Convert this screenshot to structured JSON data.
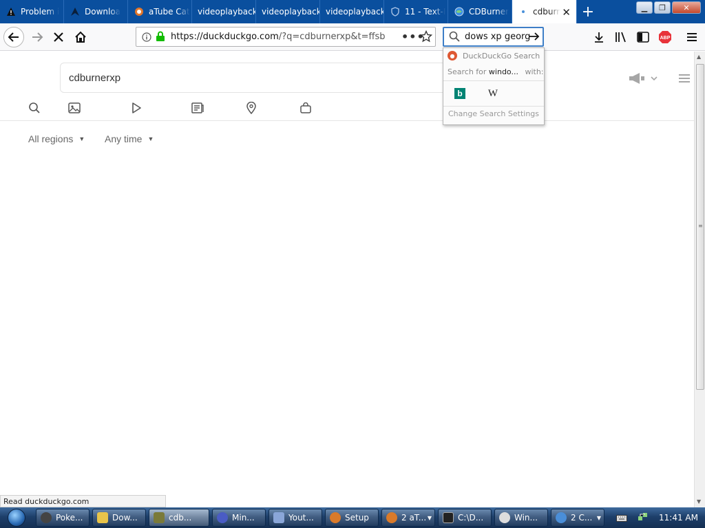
{
  "tabs": [
    {
      "label": "Problem i",
      "icon": "warning-icon"
    },
    {
      "label": "Downloa",
      "icon": "arrow-up-icon"
    },
    {
      "label": "aTube Cat",
      "icon": "atube-icon"
    },
    {
      "label": "videoplayback",
      "icon": ""
    },
    {
      "label": "videoplayback",
      "icon": ""
    },
    {
      "label": "videoplayback",
      "icon": ""
    },
    {
      "label": "11 - Text-I",
      "icon": "shield-icon"
    },
    {
      "label": "CDBurner",
      "icon": "globe-icon"
    },
    {
      "label": "cdburn",
      "icon": "loading-dot-icon",
      "active": true
    }
  ],
  "navbar": {
    "url_host": "https://duckduckgo.com",
    "url_path": "/?q=cdburnerxp&t=ffsb",
    "search_text": "dows xp georg"
  },
  "search_popup": {
    "engine": "DuckDuckGo Search",
    "search_for_prefix": "Search for",
    "search_for_term": "windo...",
    "search_for_suffix": "with:",
    "change_settings": "Change Search Settings"
  },
  "ddg": {
    "query": "cdburnerxp",
    "filters": {
      "regions": "All regions",
      "time": "Any time"
    }
  },
  "status_text": "Read duckduckgo.com",
  "taskbar": {
    "items": [
      {
        "label": "Poke...",
        "color": "#444"
      },
      {
        "label": "Dow...",
        "color": "#e8c44a"
      },
      {
        "label": "cdb...",
        "color": "#7a7a3a",
        "active": true
      },
      {
        "label": "Min...",
        "color": "#4a5cc4"
      },
      {
        "label": "Yout...",
        "color": "#8aa6d8"
      },
      {
        "label": "Setup",
        "color": "#d97a2a"
      },
      {
        "label": "2 aT...",
        "color": "#d97a2a",
        "arrow": true
      },
      {
        "label": "C:\\D...",
        "color": "#222"
      },
      {
        "label": "Win...",
        "color": "#ddd"
      },
      {
        "label": "2 C...",
        "color": "#4a8ed8",
        "arrow": true
      }
    ],
    "clock": "11:41 AM"
  }
}
